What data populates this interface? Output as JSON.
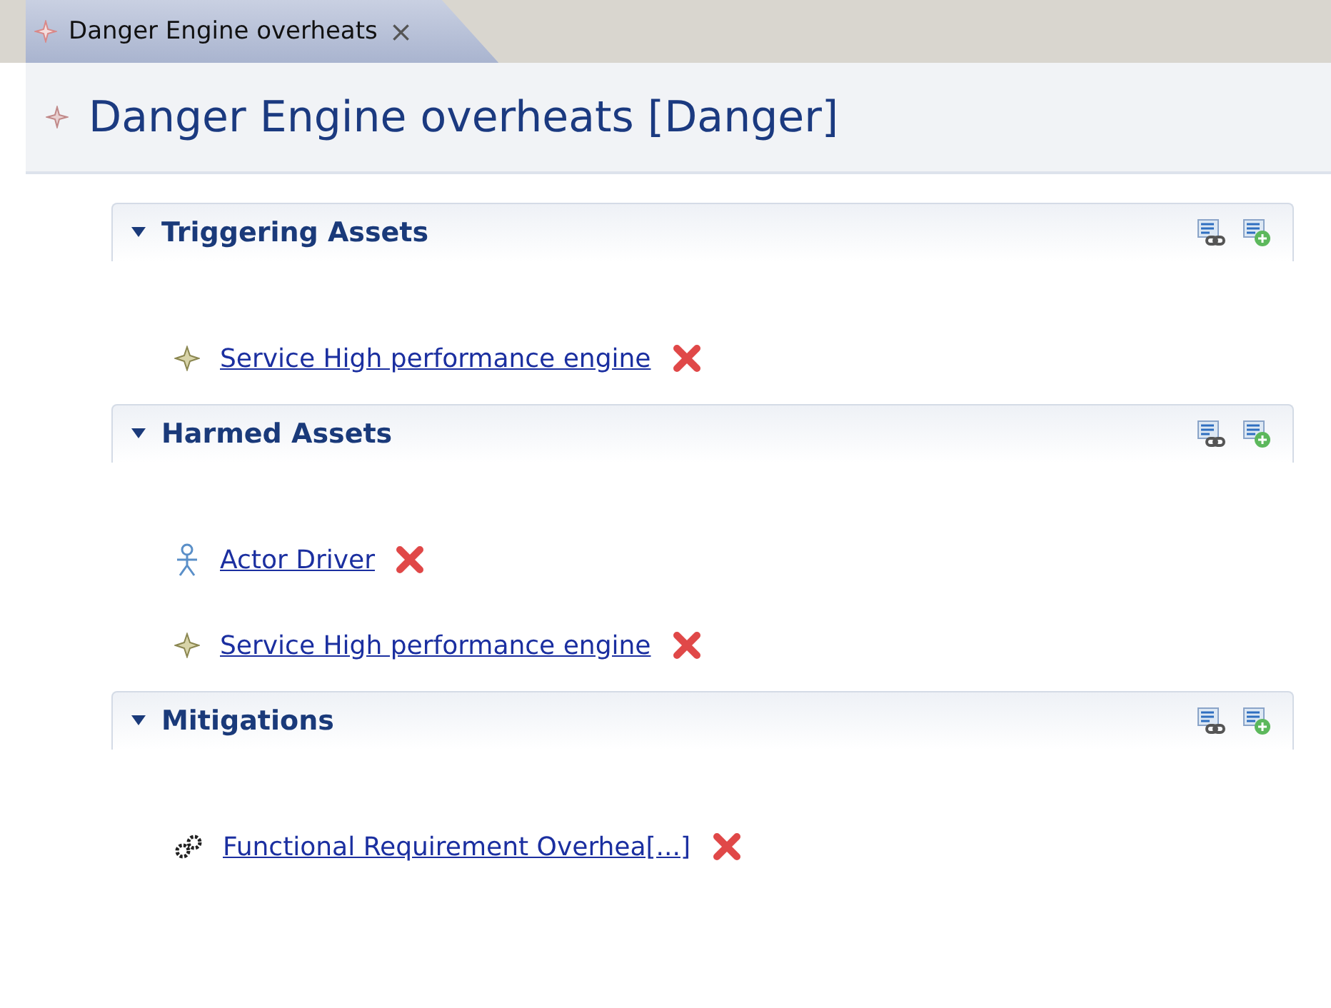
{
  "tabs": [
    {
      "label": "Danger Engine overheats",
      "close": "×",
      "selected": true
    }
  ],
  "title": "Danger Engine overheats [Danger]",
  "sections": [
    {
      "title": "Triggering Assets",
      "expanded": true,
      "items": [
        {
          "kind": "service",
          "label": "Service High performance engine"
        }
      ]
    },
    {
      "title": "Harmed Assets",
      "expanded": true,
      "items": [
        {
          "kind": "actor",
          "label": "Actor Driver"
        },
        {
          "kind": "service",
          "label": "Service High performance engine"
        }
      ]
    },
    {
      "title": "Mitigations",
      "expanded": true,
      "items": [
        {
          "kind": "requirement",
          "label": "Functional Requirement Overhea[...]"
        }
      ]
    }
  ]
}
